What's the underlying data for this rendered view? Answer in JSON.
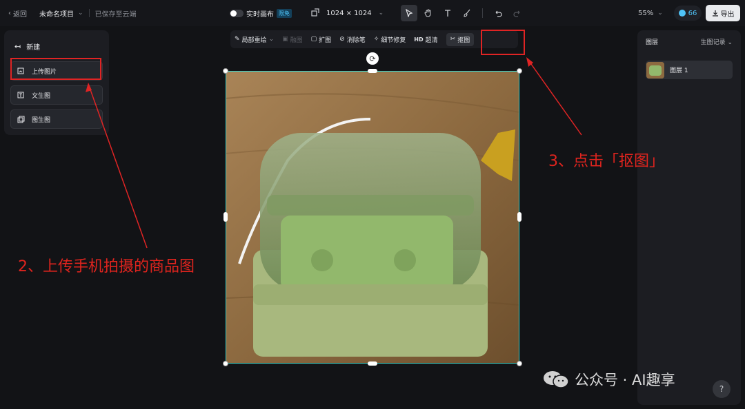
{
  "topbar": {
    "back_label": "返回",
    "project_name": "未命名项目",
    "saved_status": "已保存至云端",
    "realtime_label": "实时画布",
    "realtime_badge": "限免",
    "canvas_size": "1024 × 1024",
    "zoom": "55%",
    "credits": "66",
    "export_label": "导出"
  },
  "left_panel": {
    "title": "新建",
    "items": [
      {
        "label": "上传图片",
        "icon": "upload-image-icon"
      },
      {
        "label": "文生图",
        "icon": "text-to-image-icon"
      },
      {
        "label": "图生图",
        "icon": "image-to-image-icon"
      }
    ]
  },
  "float_toolbar": {
    "items": [
      {
        "label": "局部重绘",
        "state": "normal"
      },
      {
        "label": "融图",
        "state": "disabled"
      },
      {
        "label": "扩图",
        "state": "normal"
      },
      {
        "label": "消除笔",
        "state": "normal"
      },
      {
        "label": "细节修复",
        "state": "normal"
      },
      {
        "label": "超清",
        "prefix": "HD",
        "state": "normal"
      },
      {
        "label": "抠图",
        "state": "selected"
      }
    ]
  },
  "right_panel": {
    "title": "图层",
    "history_label": "生图记录",
    "layers": [
      {
        "name": "图层 1"
      }
    ]
  },
  "annotations": {
    "step2": "2、上传手机拍摄的商品图",
    "step3": "3、点击「抠图」"
  },
  "watermark": "公众号 · AI趣享",
  "help_label": "?",
  "colors": {
    "accent": "#3fd1c6",
    "annotation": "#e02424",
    "background": "#121316",
    "panel": "#1c1d22"
  }
}
